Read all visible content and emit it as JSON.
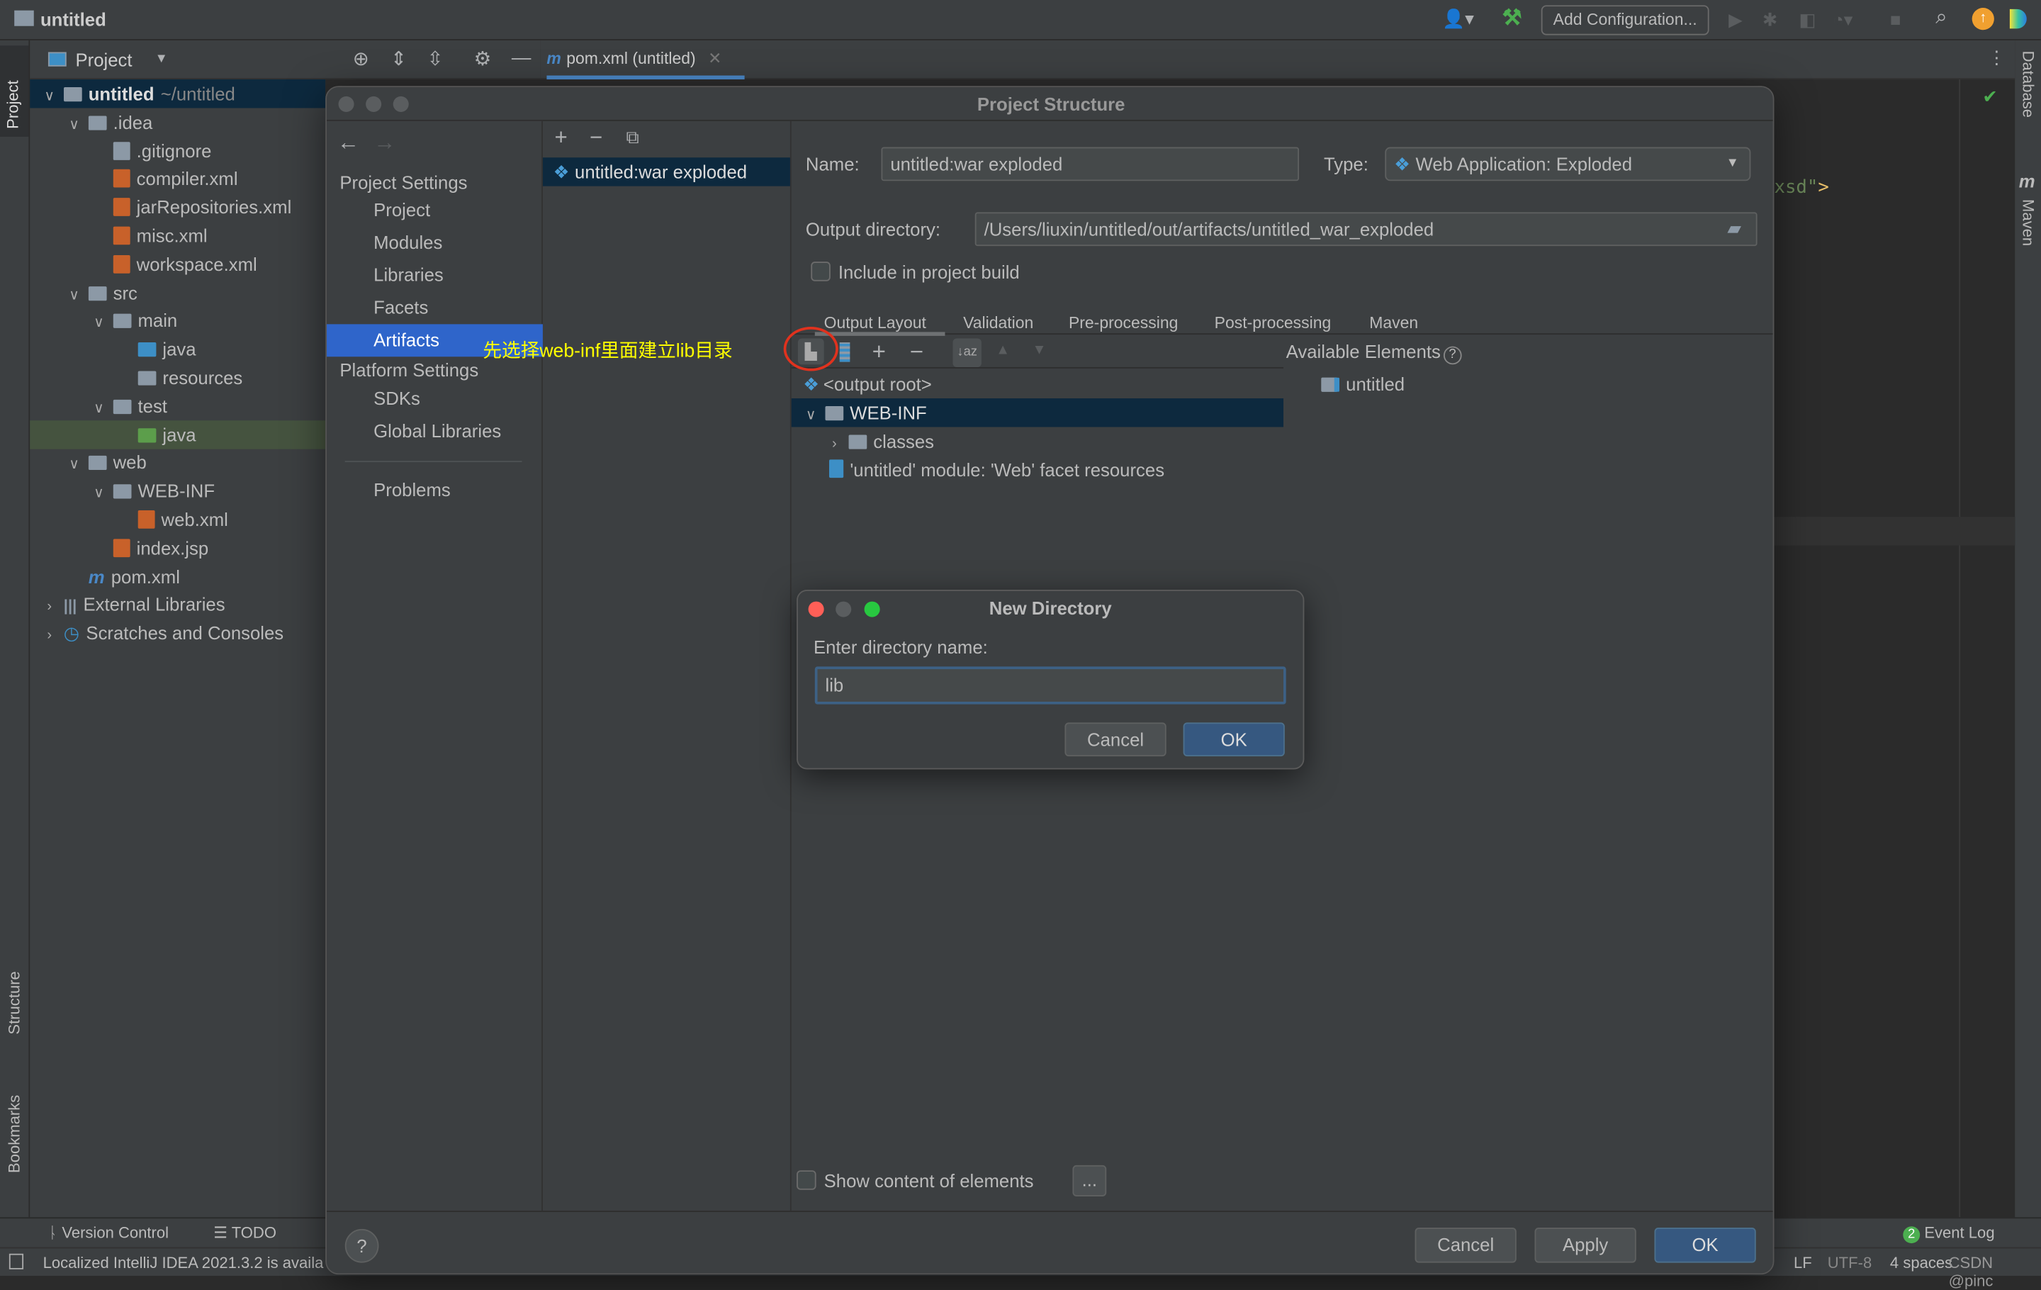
{
  "window": {
    "title": "untitled",
    "run_config": "Add Configuration..."
  },
  "left_strip": {
    "project": "Project",
    "structure": "Structure",
    "bookmarks": "Bookmarks"
  },
  "right_strip": {
    "database": "Database",
    "maven": "Maven"
  },
  "project_panel": {
    "title": "Project",
    "tree": [
      {
        "label": "untitled",
        "suffix": "~/untitled",
        "level": 0,
        "chev": "v",
        "icon": "folder",
        "bold": true
      },
      {
        "label": ".idea",
        "level": 1,
        "chev": "v",
        "icon": "folder"
      },
      {
        "label": ".gitignore",
        "level": 2,
        "icon": "file"
      },
      {
        "label": "compiler.xml",
        "level": 2,
        "icon": "xml"
      },
      {
        "label": "jarRepositories.xml",
        "level": 2,
        "icon": "xml"
      },
      {
        "label": "misc.xml",
        "level": 2,
        "icon": "xml"
      },
      {
        "label": "workspace.xml",
        "level": 2,
        "icon": "xml"
      },
      {
        "label": "src",
        "level": 1,
        "chev": "v",
        "icon": "folder"
      },
      {
        "label": "main",
        "level": 2,
        "chev": "v",
        "icon": "folder"
      },
      {
        "label": "java",
        "level": 3,
        "icon": "folder-blue"
      },
      {
        "label": "resources",
        "level": 3,
        "icon": "folder"
      },
      {
        "label": "test",
        "level": 2,
        "chev": "v",
        "icon": "folder"
      },
      {
        "label": "java",
        "level": 3,
        "icon": "folder-green",
        "highlight": true
      },
      {
        "label": "web",
        "level": 1,
        "chev": "v",
        "icon": "folder"
      },
      {
        "label": "WEB-INF",
        "level": 2,
        "chev": "v",
        "icon": "folder"
      },
      {
        "label": "web.xml",
        "level": 3,
        "icon": "xml"
      },
      {
        "label": "index.jsp",
        "level": 2,
        "icon": "jsp"
      },
      {
        "label": "pom.xml",
        "level": 1,
        "icon": "maven"
      },
      {
        "label": "External Libraries",
        "level": 0,
        "chev": ">",
        "icon": "library"
      },
      {
        "label": "Scratches and Consoles",
        "level": 0,
        "chev": ">",
        "icon": "scratch"
      }
    ]
  },
  "editor": {
    "tab": "pom.xml (untitled)",
    "code_fragment_green": "xsd\"",
    "code_fragment_orange": ">"
  },
  "dialog": {
    "title": "Project Structure",
    "nav": {
      "project_settings": "Project Settings",
      "project_items": [
        "Project",
        "Modules",
        "Libraries",
        "Facets",
        "Artifacts"
      ],
      "platform_settings": "Platform Settings",
      "platform_items": [
        "SDKs",
        "Global Libraries"
      ],
      "problems": "Problems",
      "selected": "Artifacts"
    },
    "artifact": "untitled:war exploded",
    "annotation": "先选择web-inf里面建立lib目录",
    "name_label": "Name:",
    "name_value": "untitled:war exploded",
    "type_label": "Type:",
    "type_value": "Web Application: Exploded",
    "output_label": "Output directory:",
    "output_value": "/Users/liuxin/untitled/out/artifacts/untitled_war_exploded",
    "include_label": "Include in project build",
    "include_checked": false,
    "tabs": [
      "Output Layout",
      "Validation",
      "Pre-processing",
      "Post-processing",
      "Maven"
    ],
    "active_tab": "Output Layout",
    "layout_tree": {
      "root": "<output root>",
      "webinf": "WEB-INF",
      "classes": "classes",
      "facet": "'untitled' module: 'Web' facet resources"
    },
    "available_label": "Available Elements",
    "available_items": [
      "untitled"
    ],
    "show_content_label": "Show content of elements",
    "show_content_checked": false,
    "ellipsis": "...",
    "help": "?",
    "cancel": "Cancel",
    "apply": "Apply",
    "ok": "OK"
  },
  "new_directory": {
    "title": "New Directory",
    "prompt": "Enter directory name:",
    "value": "lib",
    "cancel": "Cancel",
    "ok": "OK"
  },
  "tool_bar": {
    "version_control": "Version Control",
    "todo": "TODO",
    "event_log": "Event Log",
    "event_count": "2"
  },
  "status_bar": {
    "message": "Localized IntelliJ IDEA 2021.3.2 is availa",
    "lf": "LF",
    "encoding": "UTF-8",
    "indent": "4 spaces",
    "watermark": "CSDN @pinc"
  },
  "colors": {
    "accent": "#2f65ca",
    "selection": "#0d293e",
    "annotation": "#ffff00",
    "circle": "#e0321e",
    "primary_button": "#365880"
  }
}
